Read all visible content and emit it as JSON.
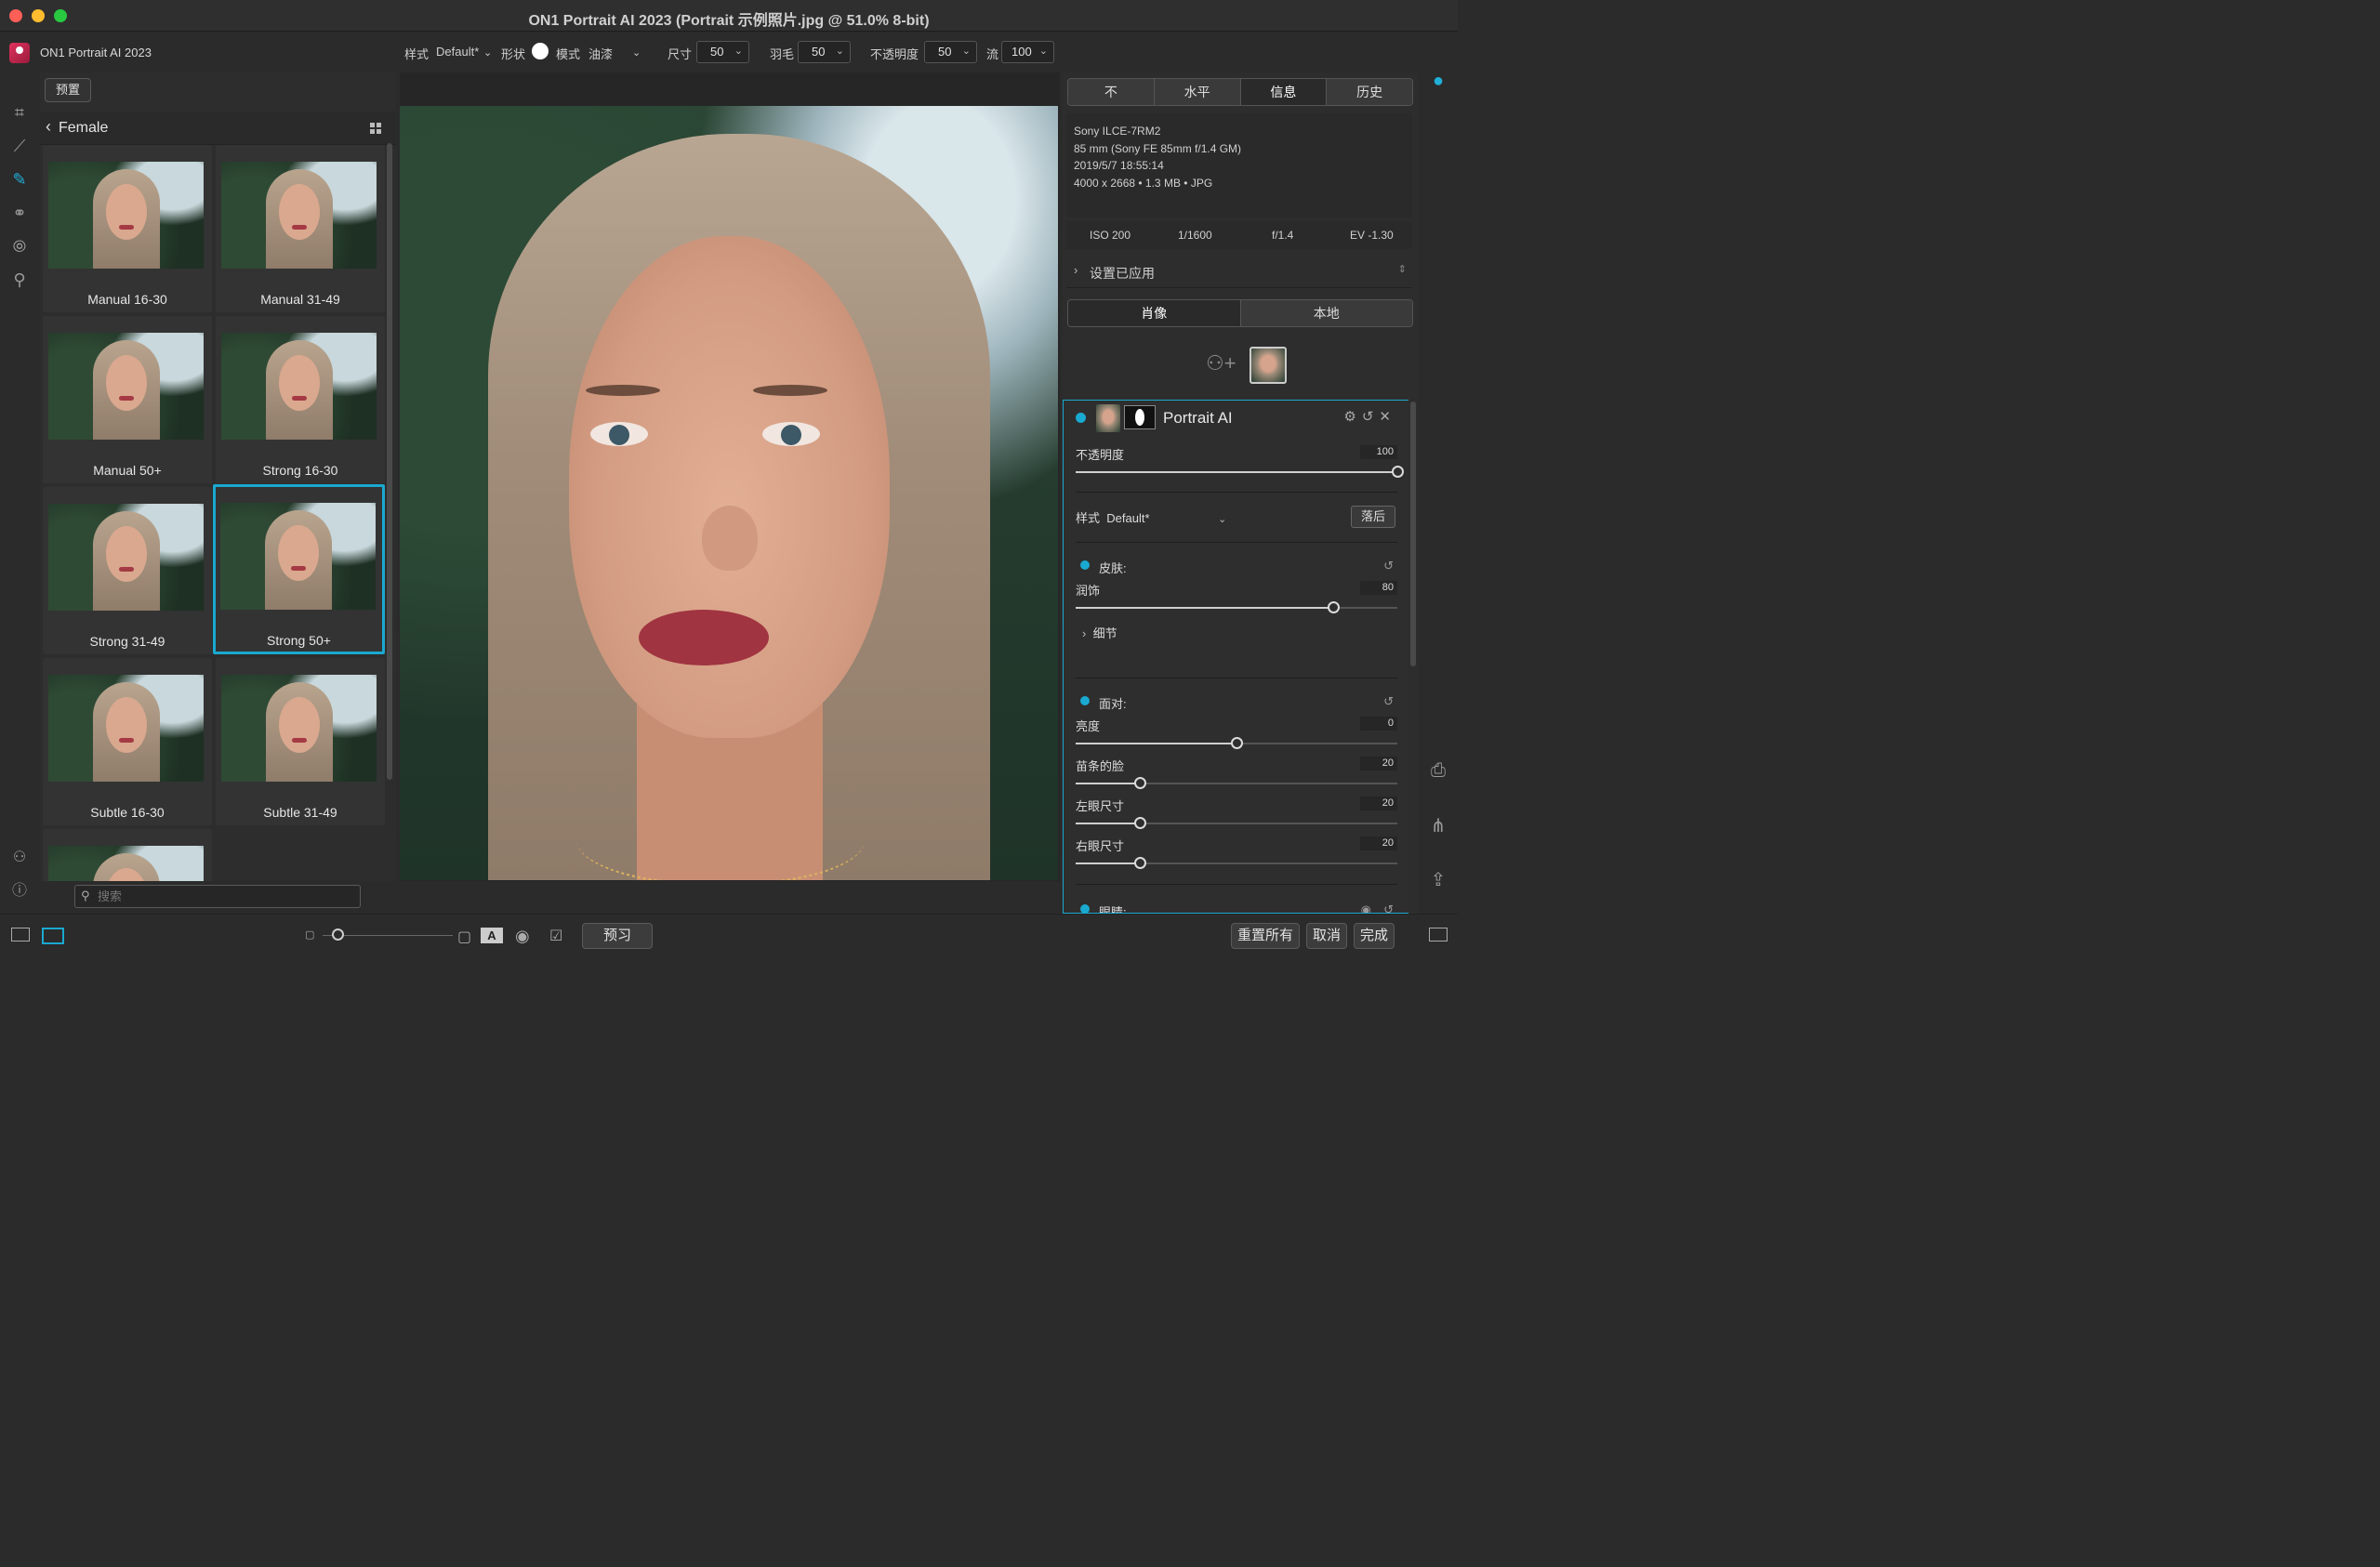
{
  "window": {
    "title": "ON1 Portrait AI 2023 (Portrait 示例照片.jpg @ 51.0% 8-bit)"
  },
  "toolbar": {
    "app_name": "ON1 Portrait AI 2023",
    "style_label": "样式",
    "style_value": "Default*",
    "shape_label": "形状",
    "mode_label": "模式",
    "mode_value": "油漆",
    "size_label": "尺寸",
    "size_value": "50",
    "feather_label": "羽毛",
    "feather_value": "50",
    "opacity_label": "不透明度",
    "opacity_value": "50",
    "flow_label": "流",
    "flow_value": "100"
  },
  "browser": {
    "preset_button": "预置",
    "folder": "Female",
    "thumbnails": [
      "Manual 16-30",
      "Manual 31-49",
      "Manual 50+",
      "Strong 16-30",
      "Strong 31-49",
      "Strong 50+",
      "Subtle 16-30",
      "Subtle 31-49"
    ],
    "selected": "Strong 50+",
    "search_placeholder": "搜索"
  },
  "info": {
    "tabs": [
      "不",
      "水平",
      "信息",
      "历史"
    ],
    "active_tab": "信息",
    "camera": "Sony ILCE-7RM2",
    "lens": "85 mm (Sony FE 85mm f/1.4 GM)",
    "datetime": "2019/5/7  18:55:14",
    "file": "4000 x 2668 • 1.3 MB • JPG",
    "iso": "ISO 200",
    "shutter": "1/1600",
    "aperture": "f/1.4",
    "ev": "EV -1.30",
    "applied_label": "设置已应用"
  },
  "mode_tabs": {
    "portrait": "肖像",
    "local": "本地"
  },
  "filter": {
    "title": "Portrait AI",
    "opacity_label": "不透明度",
    "opacity_value": "100",
    "opacity_level": 1.0,
    "style_label": "样式",
    "style_value": "Default*",
    "style_button": "落后",
    "skin_header": "皮肤:",
    "smoothing_label": "润饰",
    "smoothing_value": "80",
    "smoothing_level": 0.8,
    "detail_label": "细节",
    "face_header": "面对:",
    "brightness_label": "亮度",
    "brightness_value": "0",
    "brightness_level": 0.5,
    "slim_label": "苗条的脸",
    "slim_value": "20",
    "slim_level": 0.2,
    "left_eye_label": "左眼尺寸",
    "left_eye_value": "20",
    "left_eye_level": 0.2,
    "right_eye_label": "右眼尺寸",
    "right_eye_value": "20",
    "right_eye_level": 0.2,
    "eyes_header": "眼睛:"
  },
  "bottom": {
    "preview_button": "预习",
    "reset_all_button": "重置所有",
    "cancel_button": "取消",
    "done_button": "完成"
  },
  "colors": {
    "accent": "#1aa9d0",
    "background": "#2b2b2b"
  }
}
